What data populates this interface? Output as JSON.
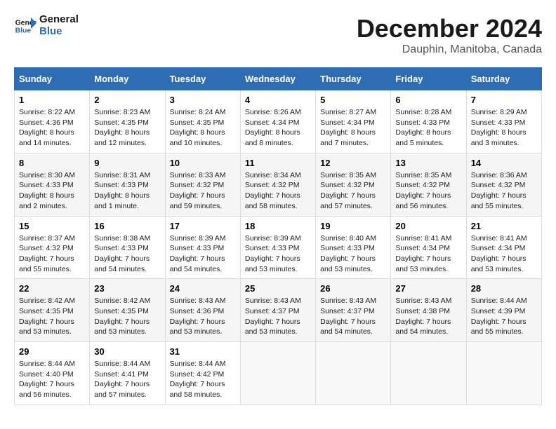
{
  "logo": {
    "line1": "General",
    "line2": "Blue"
  },
  "title": "December 2024",
  "subtitle": "Dauphin, Manitoba, Canada",
  "days_header": [
    "Sunday",
    "Monday",
    "Tuesday",
    "Wednesday",
    "Thursday",
    "Friday",
    "Saturday"
  ],
  "weeks": [
    [
      {
        "day": "1",
        "sunrise": "Sunrise: 8:22 AM",
        "sunset": "Sunset: 4:36 PM",
        "daylight": "Daylight: 8 hours and 14 minutes."
      },
      {
        "day": "2",
        "sunrise": "Sunrise: 8:23 AM",
        "sunset": "Sunset: 4:35 PM",
        "daylight": "Daylight: 8 hours and 12 minutes."
      },
      {
        "day": "3",
        "sunrise": "Sunrise: 8:24 AM",
        "sunset": "Sunset: 4:35 PM",
        "daylight": "Daylight: 8 hours and 10 minutes."
      },
      {
        "day": "4",
        "sunrise": "Sunrise: 8:26 AM",
        "sunset": "Sunset: 4:34 PM",
        "daylight": "Daylight: 8 hours and 8 minutes."
      },
      {
        "day": "5",
        "sunrise": "Sunrise: 8:27 AM",
        "sunset": "Sunset: 4:34 PM",
        "daylight": "Daylight: 8 hours and 7 minutes."
      },
      {
        "day": "6",
        "sunrise": "Sunrise: 8:28 AM",
        "sunset": "Sunset: 4:33 PM",
        "daylight": "Daylight: 8 hours and 5 minutes."
      },
      {
        "day": "7",
        "sunrise": "Sunrise: 8:29 AM",
        "sunset": "Sunset: 4:33 PM",
        "daylight": "Daylight: 8 hours and 3 minutes."
      }
    ],
    [
      {
        "day": "8",
        "sunrise": "Sunrise: 8:30 AM",
        "sunset": "Sunset: 4:33 PM",
        "daylight": "Daylight: 8 hours and 2 minutes."
      },
      {
        "day": "9",
        "sunrise": "Sunrise: 8:31 AM",
        "sunset": "Sunset: 4:33 PM",
        "daylight": "Daylight: 8 hours and 1 minute."
      },
      {
        "day": "10",
        "sunrise": "Sunrise: 8:33 AM",
        "sunset": "Sunset: 4:32 PM",
        "daylight": "Daylight: 7 hours and 59 minutes."
      },
      {
        "day": "11",
        "sunrise": "Sunrise: 8:34 AM",
        "sunset": "Sunset: 4:32 PM",
        "daylight": "Daylight: 7 hours and 58 minutes."
      },
      {
        "day": "12",
        "sunrise": "Sunrise: 8:35 AM",
        "sunset": "Sunset: 4:32 PM",
        "daylight": "Daylight: 7 hours and 57 minutes."
      },
      {
        "day": "13",
        "sunrise": "Sunrise: 8:35 AM",
        "sunset": "Sunset: 4:32 PM",
        "daylight": "Daylight: 7 hours and 56 minutes."
      },
      {
        "day": "14",
        "sunrise": "Sunrise: 8:36 AM",
        "sunset": "Sunset: 4:32 PM",
        "daylight": "Daylight: 7 hours and 55 minutes."
      }
    ],
    [
      {
        "day": "15",
        "sunrise": "Sunrise: 8:37 AM",
        "sunset": "Sunset: 4:32 PM",
        "daylight": "Daylight: 7 hours and 55 minutes."
      },
      {
        "day": "16",
        "sunrise": "Sunrise: 8:38 AM",
        "sunset": "Sunset: 4:33 PM",
        "daylight": "Daylight: 7 hours and 54 minutes."
      },
      {
        "day": "17",
        "sunrise": "Sunrise: 8:39 AM",
        "sunset": "Sunset: 4:33 PM",
        "daylight": "Daylight: 7 hours and 54 minutes."
      },
      {
        "day": "18",
        "sunrise": "Sunrise: 8:39 AM",
        "sunset": "Sunset: 4:33 PM",
        "daylight": "Daylight: 7 hours and 53 minutes."
      },
      {
        "day": "19",
        "sunrise": "Sunrise: 8:40 AM",
        "sunset": "Sunset: 4:33 PM",
        "daylight": "Daylight: 7 hours and 53 minutes."
      },
      {
        "day": "20",
        "sunrise": "Sunrise: 8:41 AM",
        "sunset": "Sunset: 4:34 PM",
        "daylight": "Daylight: 7 hours and 53 minutes."
      },
      {
        "day": "21",
        "sunrise": "Sunrise: 8:41 AM",
        "sunset": "Sunset: 4:34 PM",
        "daylight": "Daylight: 7 hours and 53 minutes."
      }
    ],
    [
      {
        "day": "22",
        "sunrise": "Sunrise: 8:42 AM",
        "sunset": "Sunset: 4:35 PM",
        "daylight": "Daylight: 7 hours and 53 minutes."
      },
      {
        "day": "23",
        "sunrise": "Sunrise: 8:42 AM",
        "sunset": "Sunset: 4:35 PM",
        "daylight": "Daylight: 7 hours and 53 minutes."
      },
      {
        "day": "24",
        "sunrise": "Sunrise: 8:43 AM",
        "sunset": "Sunset: 4:36 PM",
        "daylight": "Daylight: 7 hours and 53 minutes."
      },
      {
        "day": "25",
        "sunrise": "Sunrise: 8:43 AM",
        "sunset": "Sunset: 4:37 PM",
        "daylight": "Daylight: 7 hours and 53 minutes."
      },
      {
        "day": "26",
        "sunrise": "Sunrise: 8:43 AM",
        "sunset": "Sunset: 4:37 PM",
        "daylight": "Daylight: 7 hours and 54 minutes."
      },
      {
        "day": "27",
        "sunrise": "Sunrise: 8:43 AM",
        "sunset": "Sunset: 4:38 PM",
        "daylight": "Daylight: 7 hours and 54 minutes."
      },
      {
        "day": "28",
        "sunrise": "Sunrise: 8:44 AM",
        "sunset": "Sunset: 4:39 PM",
        "daylight": "Daylight: 7 hours and 55 minutes."
      }
    ],
    [
      {
        "day": "29",
        "sunrise": "Sunrise: 8:44 AM",
        "sunset": "Sunset: 4:40 PM",
        "daylight": "Daylight: 7 hours and 56 minutes."
      },
      {
        "day": "30",
        "sunrise": "Sunrise: 8:44 AM",
        "sunset": "Sunset: 4:41 PM",
        "daylight": "Daylight: 7 hours and 57 minutes."
      },
      {
        "day": "31",
        "sunrise": "Sunrise: 8:44 AM",
        "sunset": "Sunset: 4:42 PM",
        "daylight": "Daylight: 7 hours and 58 minutes."
      },
      null,
      null,
      null,
      null
    ]
  ]
}
